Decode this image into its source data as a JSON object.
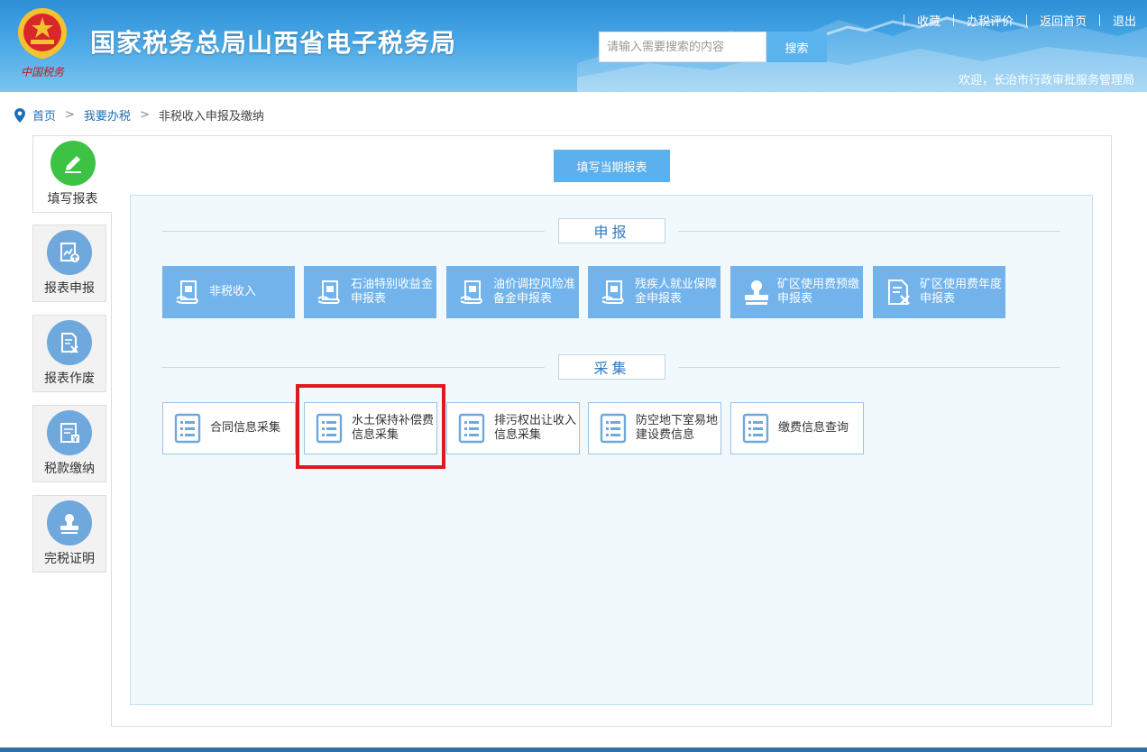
{
  "header": {
    "title": "国家税务总局山西省电子税务局",
    "emblem_text": "中国税务",
    "search_placeholder": "请输入需要搜索的内容",
    "search_button": "搜索",
    "links": [
      "收藏",
      "办税评价",
      "返回首页",
      "退出"
    ],
    "welcome": "欢迎，长治市行政审批服务管理局"
  },
  "breadcrumb": {
    "home": "首页",
    "section": "我要办税",
    "current": "非税收入申报及缴纳",
    "separator": ">"
  },
  "sidebar": {
    "items": [
      {
        "label": "填写报表",
        "icon": "pencil-icon",
        "active": true
      },
      {
        "label": "报表申报",
        "icon": "report-upload-icon",
        "active": false
      },
      {
        "label": "报表作废",
        "icon": "report-cancel-icon",
        "active": false
      },
      {
        "label": "税款缴纳",
        "icon": "tax-payment-icon",
        "active": false
      },
      {
        "label": "完税证明",
        "icon": "stamp-icon",
        "active": false
      }
    ]
  },
  "main": {
    "fill_button": "填写当期报表",
    "declaration": {
      "title": "申报",
      "tiles": [
        {
          "label": "非税收入",
          "icon": "document-hand-icon"
        },
        {
          "label": "石油特别收益金申报表",
          "icon": "document-hand-icon"
        },
        {
          "label": "油价调控风险准备金申报表",
          "icon": "document-hand-icon"
        },
        {
          "label": "残疾人就业保障金申报表",
          "icon": "document-hand-icon"
        },
        {
          "label": "矿区使用费预缴申报表",
          "icon": "stamp-icon"
        },
        {
          "label": "矿区使用费年度申报表",
          "icon": "document-cancel-icon"
        }
      ]
    },
    "collection": {
      "title": "采集",
      "tiles": [
        {
          "label": "合同信息采集",
          "icon": "list-document-icon"
        },
        {
          "label": "水土保持补偿费信息采集",
          "icon": "list-document-icon",
          "highlighted": true
        },
        {
          "label": "排污权出让收入信息采集",
          "icon": "list-document-icon"
        },
        {
          "label": "防空地下室易地建设费信息",
          "icon": "list-document-icon"
        },
        {
          "label": "缴费信息查询",
          "icon": "list-document-icon"
        }
      ]
    }
  },
  "colors": {
    "header_blue": "#2e8fd6",
    "tile_blue": "#72b3ec",
    "active_green": "#3dc343",
    "highlight_red": "#e0191e",
    "link_blue": "#1f6eb5"
  }
}
